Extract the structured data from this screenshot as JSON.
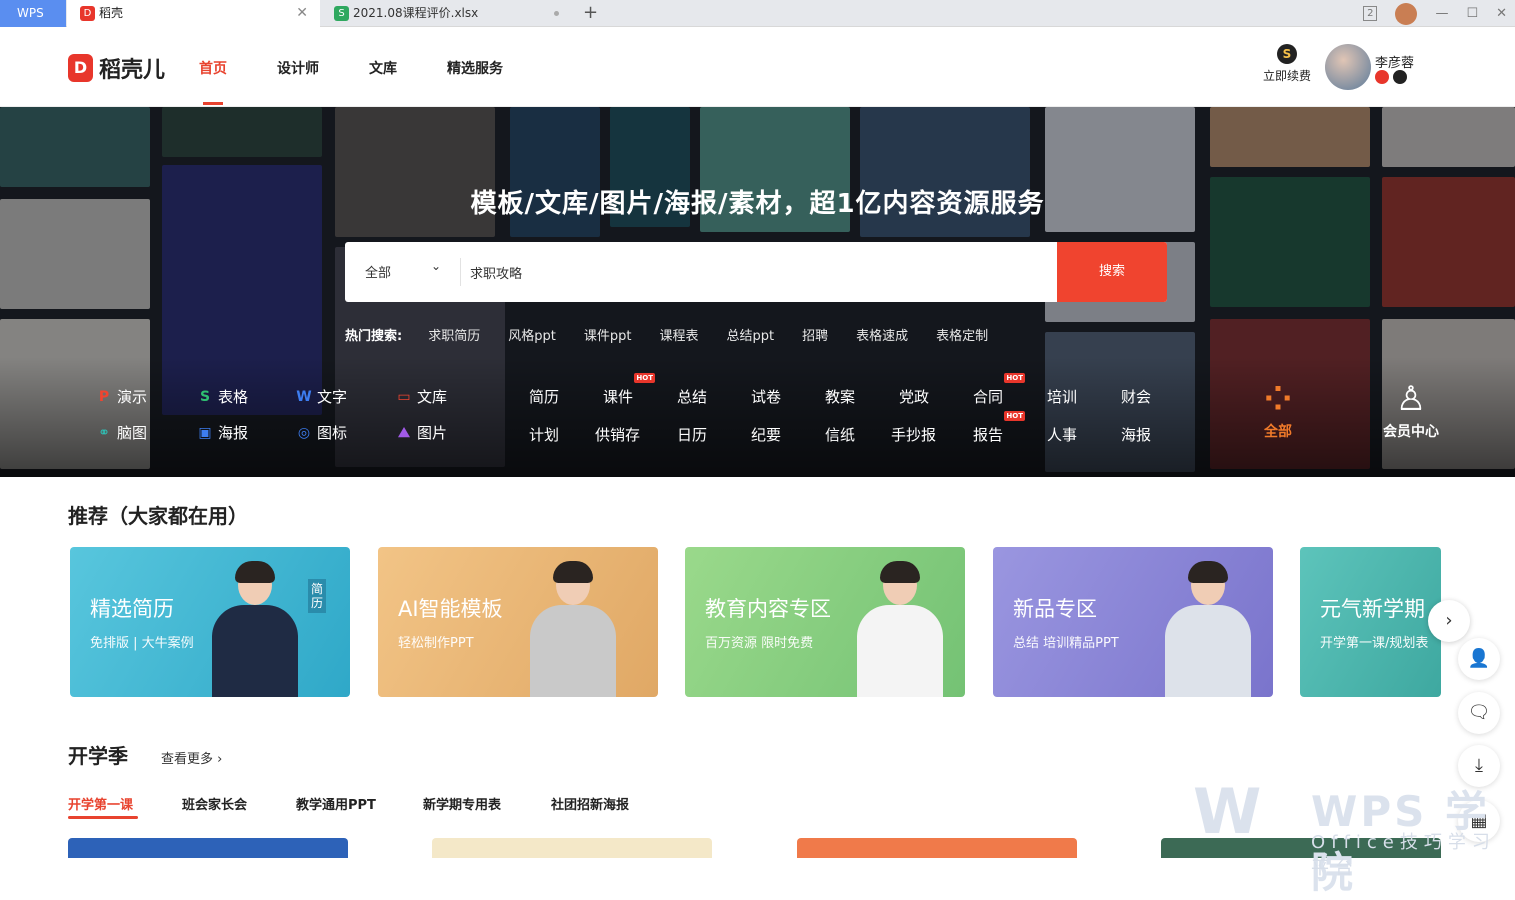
{
  "titlebar": {
    "app": "WPS",
    "tabs": [
      {
        "label": "稻壳",
        "icon": "docer-icon"
      },
      {
        "label": "2021.08课程评价.xlsx",
        "icon": "spreadsheet-icon"
      }
    ],
    "badge": "2"
  },
  "nav": {
    "logo": "稻壳儿",
    "items": [
      "首页",
      "设计师",
      "文库",
      "精选服务"
    ],
    "active": "首页",
    "renew": "立即续费",
    "username": "李彦蓉"
  },
  "hero": {
    "title": "模板/文库/图片/海报/素材，超1亿内容资源服务",
    "search": {
      "category": "全部",
      "value": "求职攻略",
      "button": "搜索"
    },
    "hot_label": "热门搜索:",
    "hot_keywords": [
      "求职简历",
      "风格ppt",
      "课件ppt",
      "课程表",
      "总结ppt",
      "招聘",
      "表格速成",
      "表格定制"
    ],
    "left_categories": [
      {
        "label": "演示",
        "icon": "ppt-icon",
        "color": "#f0442f"
      },
      {
        "label": "表格",
        "icon": "sheet-icon",
        "color": "#2fbf71"
      },
      {
        "label": "文字",
        "icon": "writer-icon",
        "color": "#3d7df0"
      },
      {
        "label": "文库",
        "icon": "library-icon",
        "color": "#f0442f"
      },
      {
        "label": "脑图",
        "icon": "mindmap-icon",
        "color": "#2fbfb4"
      },
      {
        "label": "海报",
        "icon": "poster-icon",
        "color": "#3d7df0"
      },
      {
        "label": "图标",
        "icon": "iconset-icon",
        "color": "#3d7df0"
      },
      {
        "label": "图片",
        "icon": "image-icon",
        "color": "#a15ae8"
      }
    ],
    "middle_row1": [
      "简历",
      "课件",
      "总结",
      "试卷",
      "教案",
      "党政",
      "合同",
      "培训",
      "财会"
    ],
    "middle_row2": [
      "计划",
      "供销存",
      "日历",
      "纪要",
      "信纸",
      "手抄报",
      "报告",
      "人事",
      "海报"
    ],
    "hot_tag": "HOT",
    "all_label": "全部",
    "member_label": "会员中心"
  },
  "recommend": {
    "title": "推荐（大家都在用）",
    "cards": [
      {
        "title": "精选简历",
        "subtitle": "免排版 | 大牛案例",
        "tag": "简历",
        "color": "#45b6d4"
      },
      {
        "title": "AI智能模板",
        "subtitle": "轻松制作PPT",
        "color": "#e8b677"
      },
      {
        "title": "教育内容专区",
        "subtitle": "百万资源 限时免费",
        "color": "#8cd08a"
      },
      {
        "title": "新品专区",
        "subtitle": "总结 培训精品PPT",
        "color": "#8a86d6"
      },
      {
        "title": "元气新学期",
        "subtitle": "开学第一课/规划表",
        "color": "#4fb8b0"
      }
    ]
  },
  "school": {
    "title": "开学季",
    "more": "查看更多",
    "tabs": [
      "开学第一课",
      "班会家长会",
      "教学通用PPT",
      "新学期专用表",
      "社团招新海报"
    ],
    "active": "开学第一课"
  },
  "watermark": {
    "brand": "WPS 学院",
    "sub": "Office技巧学习平台"
  }
}
